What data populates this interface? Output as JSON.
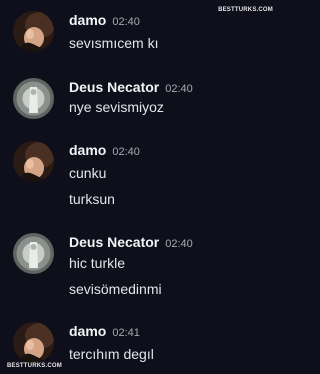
{
  "watermark_top": "BESTTURKS.COM",
  "watermark_bottom": "BESTTURKS.COM",
  "messages": [
    {
      "author": "damo",
      "time": "02:40",
      "lines": [
        "sevısmıcem kı"
      ]
    },
    {
      "author": "Deus Necator",
      "time": "02:40",
      "lines": [
        "nye sevismiyoz"
      ]
    },
    {
      "author": "damo",
      "time": "02:40",
      "lines": [
        "cunku",
        "turksun"
      ]
    },
    {
      "author": "Deus Necator",
      "time": "02:40",
      "lines": [
        "hic turkle",
        "sevisömedinmi"
      ]
    },
    {
      "author": "damo",
      "time": "02:41",
      "lines": [
        "tercıhım degıl"
      ]
    }
  ]
}
